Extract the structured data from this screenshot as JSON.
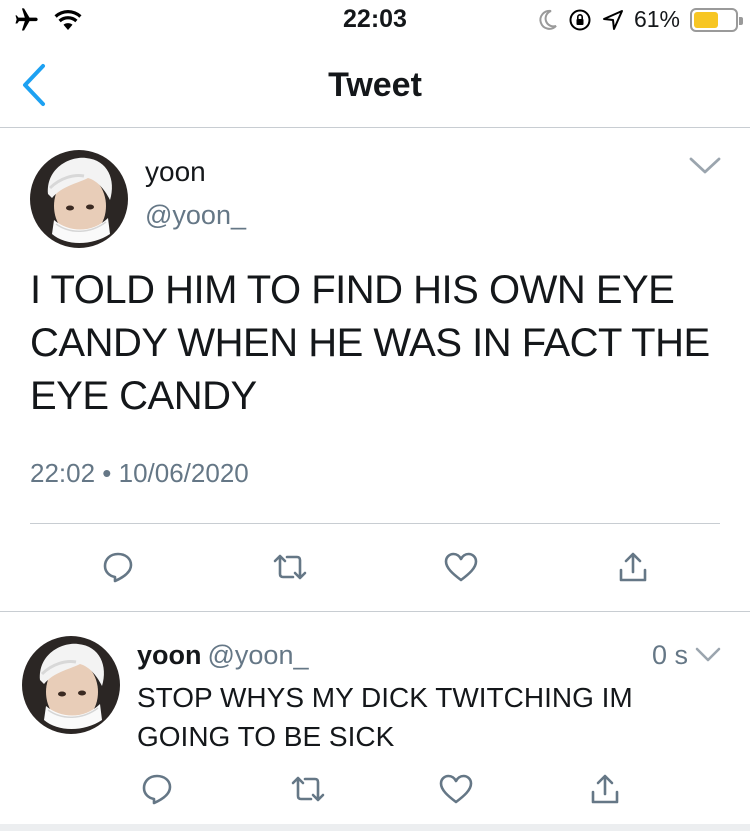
{
  "status_bar": {
    "time": "22:03",
    "battery_percent": "61%",
    "battery_level": 0.61,
    "icons": [
      "airplane-icon",
      "wifi-icon",
      "moon-icon",
      "orientation-lock-icon",
      "location-icon",
      "battery-icon"
    ]
  },
  "nav": {
    "title": "Tweet",
    "back_icon": "chevron-left-icon"
  },
  "tweet": {
    "name": "yoon",
    "handle": "@yoon_",
    "text": "I TOLD HIM TO FIND HIS OWN EYE CANDY WHEN HE WAS IN FACT THE EYE CANDY",
    "timestamp": "22:02 • 10/06/2020",
    "actions": [
      "reply-icon",
      "retweet-icon",
      "like-icon",
      "share-icon"
    ]
  },
  "reply": {
    "name": "yoon",
    "handle": "@yoon_",
    "time_ago": "0 s",
    "text": "STOP WHYS MY DICK TWITCHING IM GOING TO BE SICK",
    "actions": [
      "reply-icon",
      "retweet-icon",
      "like-icon",
      "share-icon"
    ]
  },
  "colors": {
    "accent": "#1da1f2",
    "secondary_text": "#657786",
    "icon_gray": "#657786",
    "divider": "#c8cdd2",
    "battery": "#f7c624"
  }
}
